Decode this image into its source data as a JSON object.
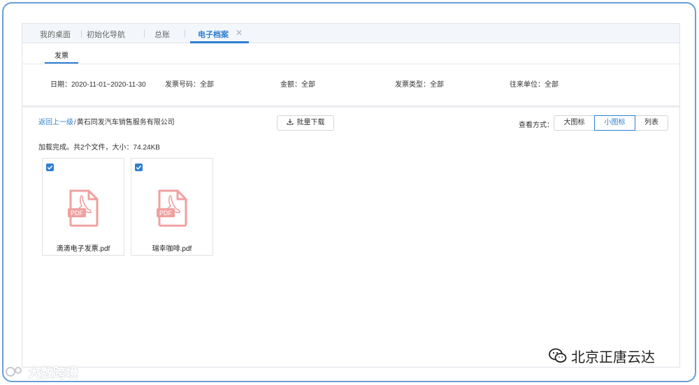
{
  "tabs": [
    {
      "label": "我的桌面"
    },
    {
      "label": "初始化导航"
    },
    {
      "label": "总账"
    },
    {
      "label": "电子档案"
    }
  ],
  "subnav": {
    "label": "发票"
  },
  "filters": {
    "date": "日期：2020-11-01~2020-11-30",
    "invoice_no": "发票号码：全部",
    "amount": "金额：全部",
    "invoice_type": "发票类型：全部",
    "counterparty": "往来单位：全部"
  },
  "breadcrumb": {
    "back": "返回上一级",
    "separator": "/",
    "current": "黄石同发汽车销售服务有限公司"
  },
  "toolbar": {
    "download_label": "批量下载"
  },
  "view": {
    "label": "查看方式：",
    "options": [
      "大图标",
      "小图标",
      "列表"
    ],
    "selected": "小图标"
  },
  "status": "加载完成。共2个文件，大小：74.24KB",
  "files": [
    {
      "name": "滴滴电子发票.pdf",
      "checked": true,
      "icon": "pdf-file-icon"
    },
    {
      "name": "瑞幸咖啡.pdf",
      "checked": true,
      "icon": "pdf-file-icon"
    }
  ],
  "pdf_badge": "PDF",
  "watermark_left": "大数跨境",
  "watermark_right": "北京正唐云达",
  "colors": {
    "accent": "#2f7fd1",
    "pdf": "#f0a0a0",
    "frame": "#6a9ed6"
  }
}
